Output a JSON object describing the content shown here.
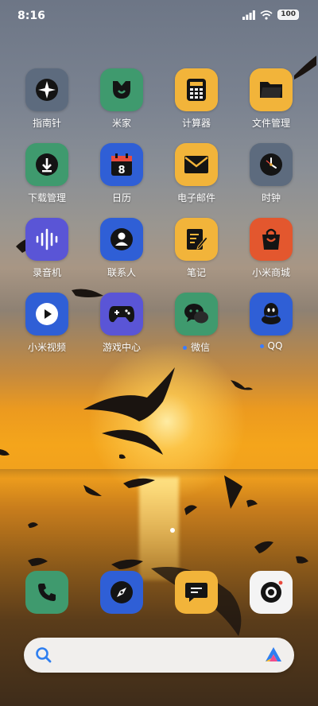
{
  "status_bar": {
    "time": "8:16",
    "battery": "100"
  },
  "apps": [
    {
      "label": "指南针",
      "icon": "compass-icon",
      "color": "#5d6b7e",
      "dot": false
    },
    {
      "label": "米家",
      "icon": "mijia-icon",
      "color": "#3f9a6e",
      "dot": false
    },
    {
      "label": "计算器",
      "icon": "calculator-icon",
      "color": "#f2b43a",
      "dot": false
    },
    {
      "label": "文件管理",
      "icon": "folder-icon",
      "color": "#f2b43a",
      "dot": false
    },
    {
      "label": "下载管理",
      "icon": "download-icon",
      "color": "#3f9a6e",
      "dot": false
    },
    {
      "label": "日历",
      "icon": "calendar-icon",
      "color": "#2f5fd6",
      "dot": false,
      "badge": "8"
    },
    {
      "label": "电子邮件",
      "icon": "mail-icon",
      "color": "#f2b43a",
      "dot": false
    },
    {
      "label": "时钟",
      "icon": "clock-icon",
      "color": "#5d6b7e",
      "dot": false
    },
    {
      "label": "录音机",
      "icon": "voice-recorder-icon",
      "color": "#5a55d6",
      "dot": false
    },
    {
      "label": "联系人",
      "icon": "contacts-icon",
      "color": "#2f5fd6",
      "dot": false
    },
    {
      "label": "笔记",
      "icon": "notes-icon",
      "color": "#f2b43a",
      "dot": false
    },
    {
      "label": "小米商城",
      "icon": "shopping-bag-icon",
      "color": "#e3572e",
      "dot": false
    },
    {
      "label": "小米视频",
      "icon": "video-play-icon",
      "color": "#2f5fd6",
      "dot": false
    },
    {
      "label": "游戏中心",
      "icon": "gamepad-icon",
      "color": "#5a55d6",
      "dot": false
    },
    {
      "label": "微信",
      "icon": "wechat-icon",
      "color": "#3f9a6e",
      "dot": true
    },
    {
      "label": "QQ",
      "icon": "qq-icon",
      "color": "#2f5fd6",
      "dot": true
    }
  ],
  "dock": [
    {
      "name": "phone",
      "icon": "phone-icon",
      "color": "#3f9a6e"
    },
    {
      "name": "browser",
      "icon": "browser-compass-icon",
      "color": "#2f5fd6"
    },
    {
      "name": "messages",
      "icon": "message-icon",
      "color": "#f2b43a"
    },
    {
      "name": "camera",
      "icon": "camera-icon",
      "color": "#f4f4f4"
    }
  ],
  "search": {
    "icon": "search-icon",
    "assistant_icon": "ai-assistant-icon"
  },
  "page_indicator": {
    "current": 1
  }
}
